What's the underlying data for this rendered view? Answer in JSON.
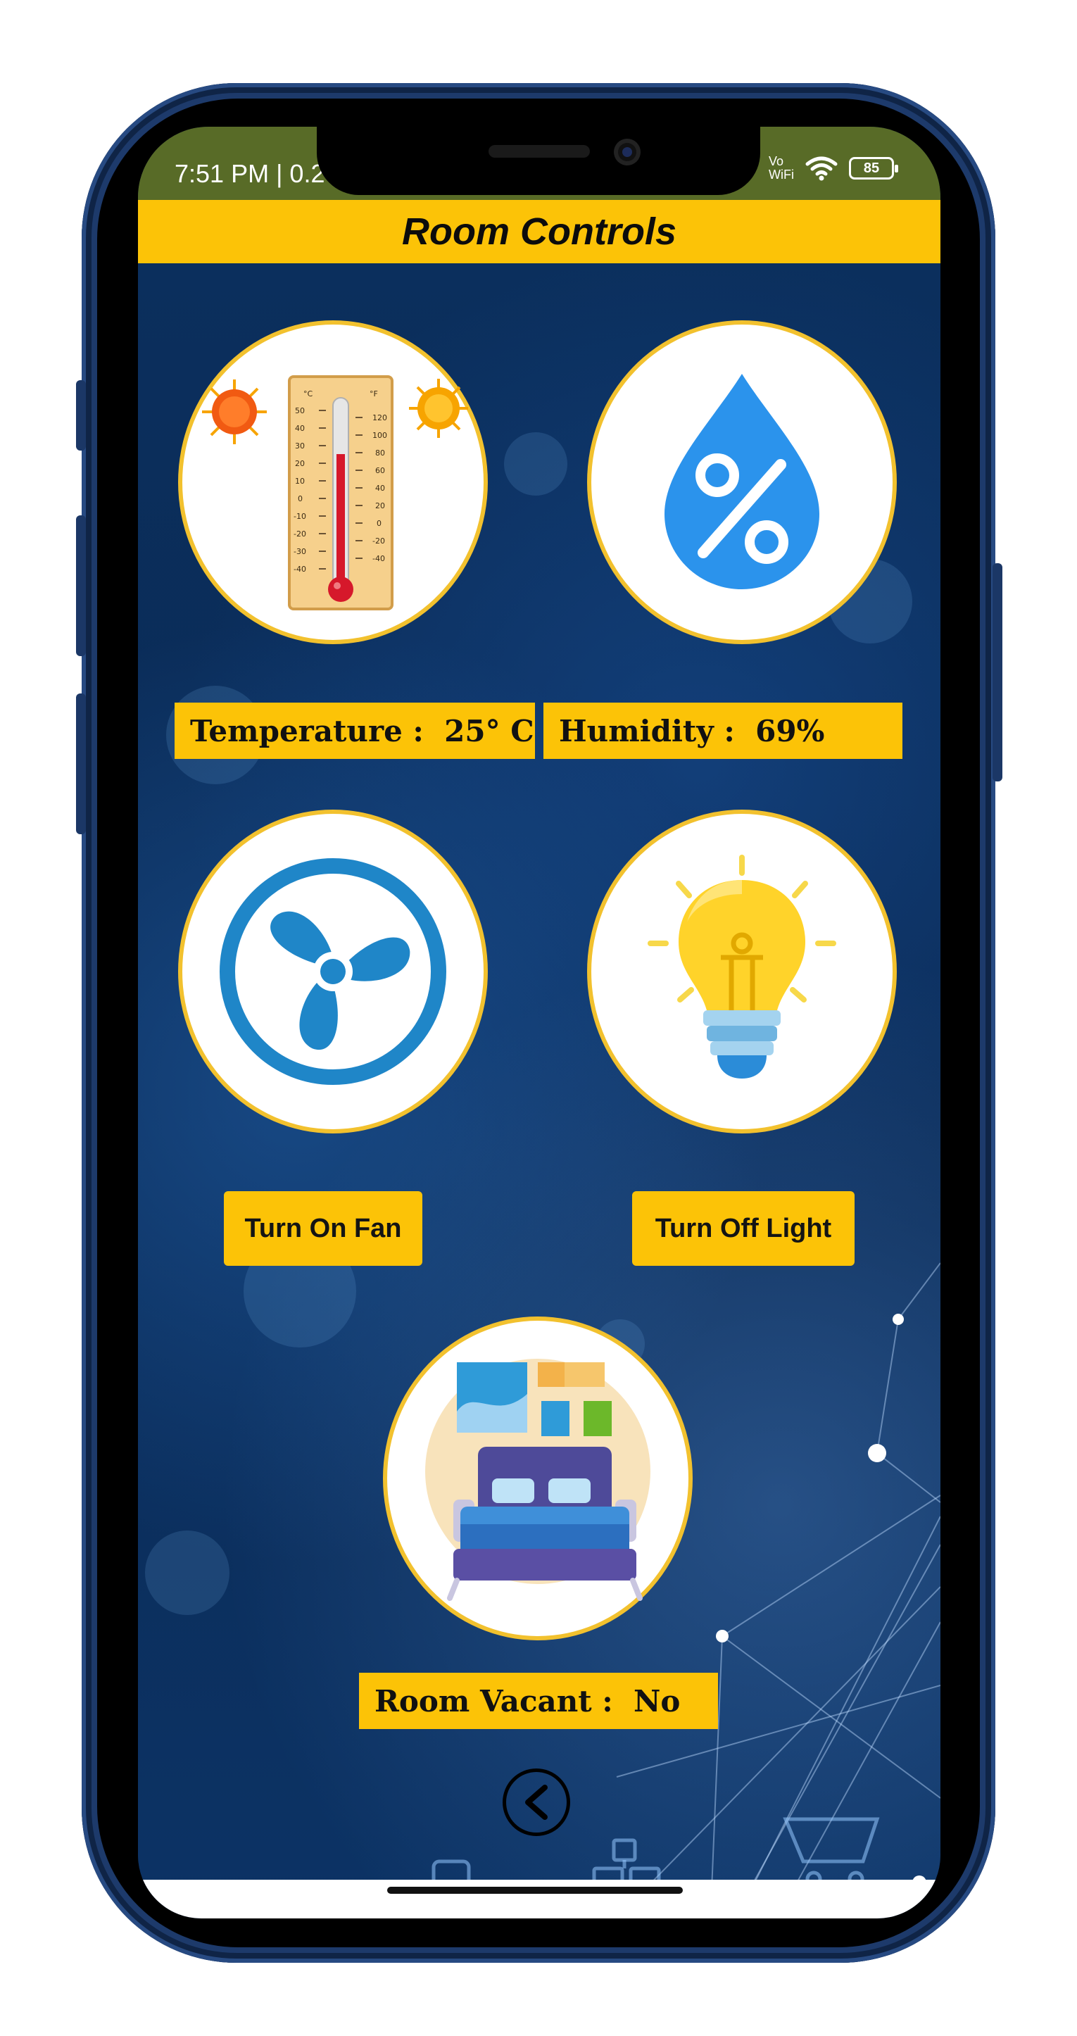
{
  "status_bar": {
    "time": "7:51 PM | 0.2",
    "network_line1": "Vo",
    "network_line2": "WiFi",
    "battery": "85",
    "icons": [
      "wifi-icon",
      "battery-icon"
    ]
  },
  "header": {
    "title": "Room Controls"
  },
  "sensors": {
    "temperature_label": "Temperature :  25° C",
    "humidity_label": "Humidity :  69%",
    "room_vacant_label": "Room Vacant :  No"
  },
  "controls": {
    "fan_button": "Turn On Fan",
    "light_button": "Turn Off Light"
  },
  "icons": {
    "temperature": "thermometer-icon",
    "humidity": "humidity-drop-icon",
    "fan": "fan-icon",
    "light": "light-bulb-icon",
    "room": "bedroom-icon",
    "back": "back-chevron-icon"
  },
  "colors": {
    "accent": "#fcc307",
    "status_bar": "#586b27",
    "background": "#0a2b52",
    "icon_blue": "#2196f3"
  }
}
